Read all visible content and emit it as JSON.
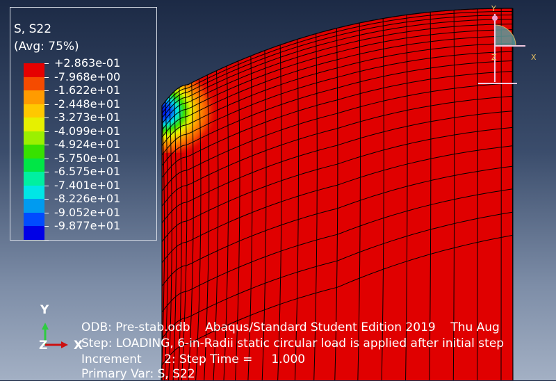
{
  "legend": {
    "title": "S, S22",
    "averaging": "(Avg: 75%)",
    "entries": [
      {
        "label": "+2.863e-01",
        "color": "#e60000"
      },
      {
        "label": "-7.968e+00",
        "color": "#f54b00"
      },
      {
        "label": "-1.622e+01",
        "color": "#ff9b00"
      },
      {
        "label": "-2.448e+01",
        "color": "#ffc800"
      },
      {
        "label": "-3.273e+01",
        "color": "#e6f000"
      },
      {
        "label": "-4.099e+01",
        "color": "#9bf000"
      },
      {
        "label": "-4.924e+01",
        "color": "#37e100"
      },
      {
        "label": "-5.750e+01",
        "color": "#00e646"
      },
      {
        "label": "-6.575e+01",
        "color": "#00f0a0"
      },
      {
        "label": "-7.401e+01",
        "color": "#00e6e6"
      },
      {
        "label": "-8.226e+01",
        "color": "#009bf0"
      },
      {
        "label": "-9.052e+01",
        "color": "#004bff"
      },
      {
        "label": "-9.877e+01",
        "color": "#0000e6"
      }
    ]
  },
  "info": {
    "odb_line": "ODB: Pre-stab.odb    Abaqus/Standard Student Edition 2019    Thu Aug",
    "step_line": "Step: LOADING, 6-in-Radii static circular load is applied after initial step",
    "increment_line": "Increment      2: Step Time =     1.000",
    "primary_var_line": "Primary Var: S, S22"
  },
  "triad": {
    "y": "Y",
    "x": "X",
    "z": "Z"
  },
  "mini_triad": {
    "y": "Y",
    "x": "X",
    "z": "Z"
  },
  "colors": {
    "mesh_fill": "#e00000",
    "mesh_lines": "#000000",
    "triad_y": "#2ecc40",
    "triad_x": "#cc1010",
    "mini_triad_y": "#e8c060",
    "mini_triad_x": "#e8c060"
  }
}
